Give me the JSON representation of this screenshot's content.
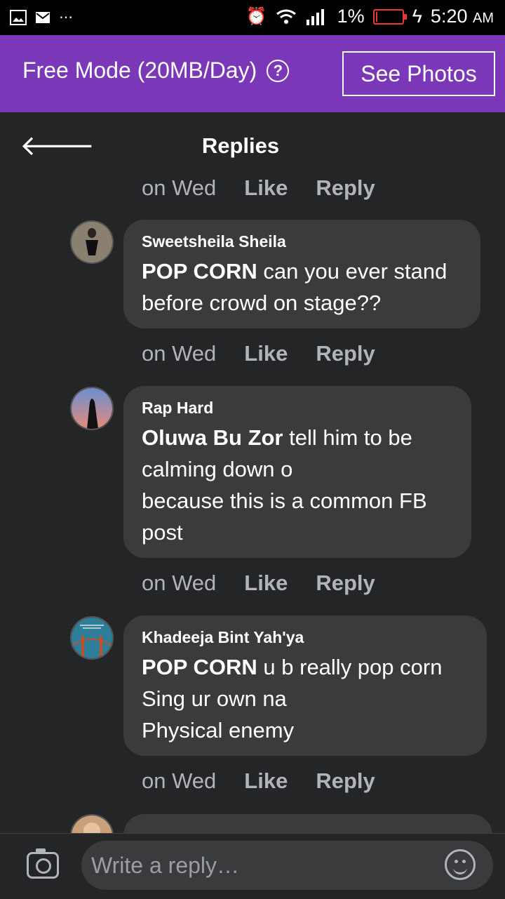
{
  "status_bar": {
    "battery_pct": "1%",
    "time": "5:20",
    "ampm": "AM"
  },
  "banner": {
    "text": "Free Mode (20MB/Day)",
    "help": "?",
    "see_photos": "See Photos"
  },
  "header": {
    "title": "Replies"
  },
  "comments": [
    {
      "author": "Sweetsheila  Sheila",
      "mention": "POP CORN",
      "text": " can you ever stand\nbefore crowd on stage??",
      "time": "on Wed",
      "like": "Like",
      "reply": "Reply"
    },
    {
      "author": "Rap Hard",
      "mention": "Oluwa Bu Zor",
      "text": " tell him to be\ncalming down o\nbecause this is a common FB\npost",
      "time": "on Wed",
      "like": "Like",
      "reply": "Reply"
    },
    {
      "author": "Khadeeja Bint Yah'ya",
      "mention": "POP CORN",
      "text": "  u b really pop corn\nSing ur own na\nPhysical enemy",
      "time": "on Wed",
      "like": "Like",
      "reply": "Reply"
    }
  ],
  "top_actions": {
    "time": "on Wed",
    "like": "Like",
    "reply": "Reply"
  },
  "composer": {
    "placeholder": "Write a reply…"
  }
}
